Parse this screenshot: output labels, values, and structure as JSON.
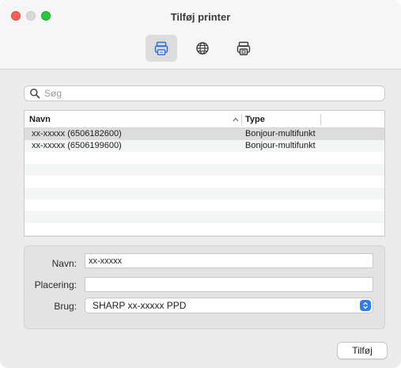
{
  "window": {
    "title": "Tilføj printer"
  },
  "toolbar": {
    "tabs": [
      {
        "icon": "printer-icon",
        "active": true
      },
      {
        "icon": "globe-icon",
        "active": false
      },
      {
        "icon": "windows-printer-icon",
        "active": false
      }
    ]
  },
  "search": {
    "placeholder": "Søg",
    "value": ""
  },
  "table": {
    "columns": {
      "name": "Navn",
      "type": "Type"
    },
    "sort": "ascending",
    "rows": [
      {
        "name": "xx-xxxxx (6506182600)",
        "type": "Bonjour-multifunkt",
        "selected": true
      },
      {
        "name": "xx-xxxxx (6506199600)",
        "type": "Bonjour-multifunkt",
        "selected": false
      }
    ]
  },
  "details": {
    "name_label": "Navn:",
    "name_value": "xx-xxxxx",
    "location_label": "Placering:",
    "location_value": "",
    "use_label": "Brug:",
    "use_value": "SHARP xx-xxxxx PPD"
  },
  "actions": {
    "add_label": "Tilføj"
  },
  "colors": {
    "accent": "#2f7bf6",
    "close": "#ff5f57",
    "zoom": "#28c840"
  }
}
